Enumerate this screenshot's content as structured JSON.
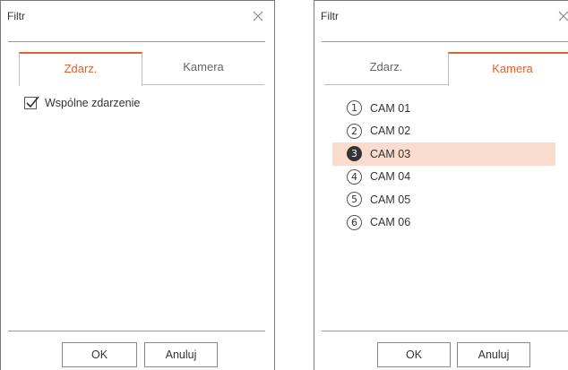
{
  "left_dialog": {
    "title": "Filtr",
    "tabs": [
      {
        "label": "Zdarz.",
        "active": true
      },
      {
        "label": "Kamera",
        "active": false
      }
    ],
    "checkbox": {
      "label": "Wspólne zdarzenie",
      "checked": true
    },
    "buttons": {
      "ok": "OK",
      "cancel": "Anuluj"
    }
  },
  "right_dialog": {
    "title": "Filtr",
    "tabs": [
      {
        "label": "Zdarz.",
        "active": false
      },
      {
        "label": "Kamera",
        "active": true
      }
    ],
    "cameras": [
      {
        "num": "1",
        "name": "CAM 01",
        "selected": false
      },
      {
        "num": "2",
        "name": "CAM 02",
        "selected": false
      },
      {
        "num": "3",
        "name": "CAM 03",
        "selected": true
      },
      {
        "num": "4",
        "name": "CAM 04",
        "selected": false
      },
      {
        "num": "5",
        "name": "CAM 05",
        "selected": false
      },
      {
        "num": "6",
        "name": "CAM 06",
        "selected": false
      }
    ],
    "buttons": {
      "ok": "OK",
      "cancel": "Anuluj"
    }
  },
  "colors": {
    "accent": "#e0622b",
    "selection": "#f9dccd",
    "border": "#7a7a7a"
  }
}
